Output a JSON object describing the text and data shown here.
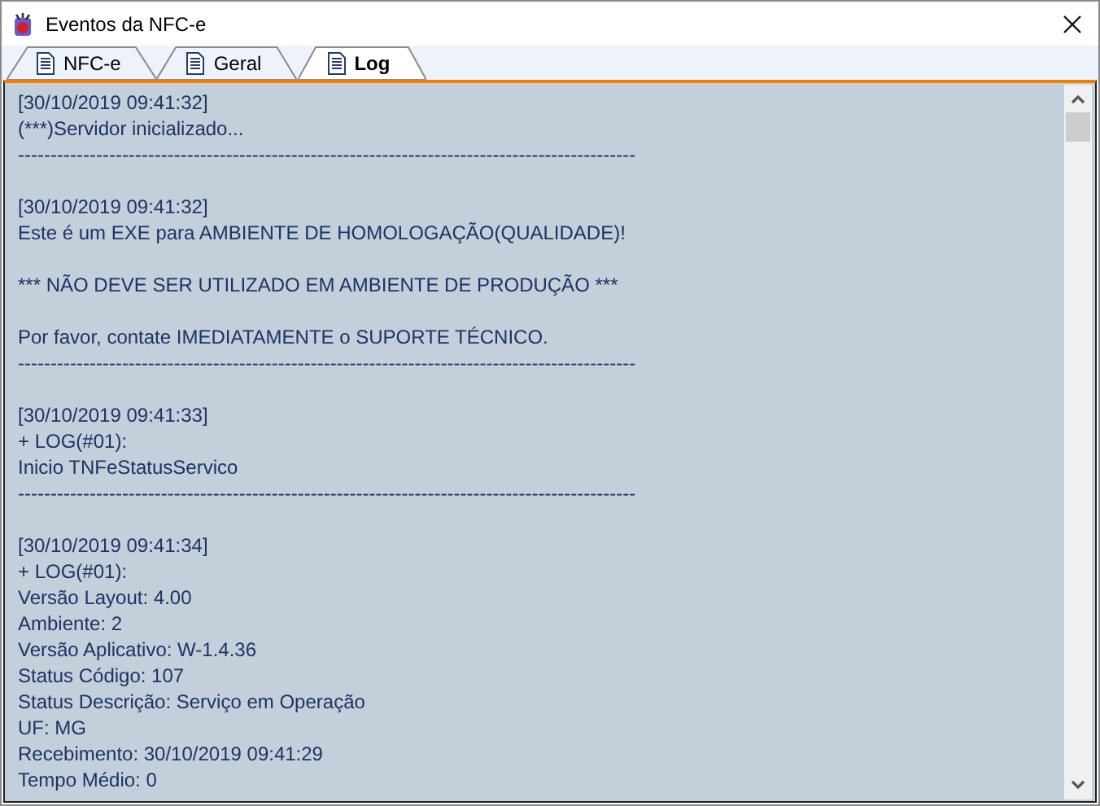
{
  "window": {
    "title": "Eventos da NFC-e"
  },
  "tabs": [
    {
      "label": "NFC-e",
      "selected": false
    },
    {
      "label": "Geral",
      "selected": false
    },
    {
      "label": "Log",
      "selected": true
    }
  ],
  "log": {
    "entries": [
      {
        "paragraphs": [
          [
            "[30/10/2019 09:41:32]",
            "(***)Servidor inicializado..."
          ]
        ],
        "separator": "-----------------------------------------------------------------------------------------------"
      },
      {
        "paragraphs": [
          [
            "[30/10/2019 09:41:32]",
            "Este é um EXE para AMBIENTE DE HOMOLOGAÇÃO(QUALIDADE)!"
          ],
          [
            "*** NÃO DEVE SER UTILIZADO EM AMBIENTE DE PRODUÇÃO ***"
          ],
          [
            "Por favor, contate IMEDIATAMENTE o SUPORTE TÉCNICO."
          ]
        ],
        "separator": "-----------------------------------------------------------------------------------------------"
      },
      {
        "paragraphs": [
          [
            "[30/10/2019 09:41:33]",
            "+ LOG(#01):",
            "Inicio TNFeStatusServico"
          ]
        ],
        "separator": "-----------------------------------------------------------------------------------------------"
      },
      {
        "paragraphs": [
          [
            "[30/10/2019 09:41:34]",
            "+ LOG(#01):",
            "Versão Layout: 4.00",
            "Ambiente: 2",
            "Versão Aplicativo: W-1.4.36",
            "Status Código: 107",
            "Status Descrição: Serviço em Operação",
            "UF: MG",
            "Recebimento: 30/10/2019 09:41:29",
            "Tempo Médio: 0"
          ]
        ]
      }
    ]
  }
}
